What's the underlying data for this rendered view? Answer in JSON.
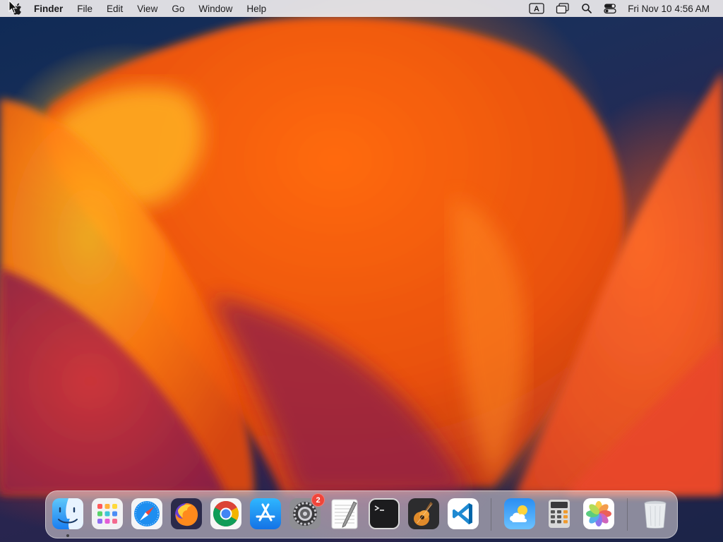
{
  "menubar": {
    "app_name": "Finder",
    "menus": [
      "File",
      "Edit",
      "View",
      "Go",
      "Window",
      "Help"
    ],
    "status_icons": [
      "keyboard-input-icon",
      "screen-mirroring-icon",
      "spotlight-search-icon",
      "control-center-icon"
    ],
    "input_source_label": "A",
    "clock": {
      "date": "Fri Nov 10",
      "time": "4:56 AM"
    }
  },
  "dock": {
    "apps": [
      {
        "name": "Finder",
        "icon": "finder-icon",
        "running": true
      },
      {
        "name": "Launchpad",
        "icon": "launchpad-icon"
      },
      {
        "name": "Safari",
        "icon": "safari-icon"
      },
      {
        "name": "Firefox",
        "icon": "firefox-icon"
      },
      {
        "name": "Google Chrome",
        "icon": "chrome-icon"
      },
      {
        "name": "App Store",
        "icon": "app-store-icon"
      },
      {
        "name": "System Settings",
        "icon": "system-settings-icon",
        "badge": "2"
      },
      {
        "name": "TextEdit",
        "icon": "textedit-icon"
      },
      {
        "name": "Terminal",
        "icon": "terminal-icon"
      },
      {
        "name": "GarageBand",
        "icon": "garageband-icon"
      },
      {
        "name": "Visual Studio Code",
        "icon": "vscode-icon"
      },
      {
        "name": "Weather",
        "icon": "weather-icon"
      },
      {
        "name": "Calculator",
        "icon": "calculator-icon"
      },
      {
        "name": "Photos",
        "icon": "photos-icon"
      },
      {
        "name": "Trash",
        "icon": "trash-icon"
      }
    ]
  },
  "colors": {
    "badge": "#f0453a",
    "menubar_bg": "#eceaec",
    "wallpaper_orange": "#f26a12",
    "wallpaper_navy": "#132b52"
  }
}
